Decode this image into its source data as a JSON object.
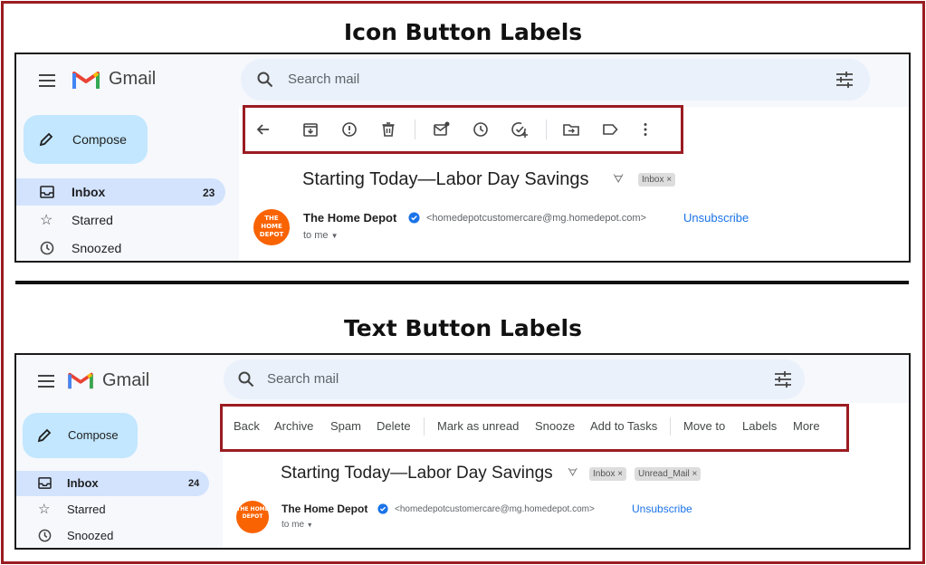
{
  "headings": {
    "top": "Icon Button Labels",
    "bottom": "Text Button Labels"
  },
  "colors": {
    "frame": "#9b1c22",
    "compose_bg": "#c2e7ff",
    "inbox_active": "#d3e3fd",
    "search_bg": "#eaf1fb",
    "link": "#1a73e8",
    "avatar": "#f96302"
  },
  "panel1": {
    "app_name": "Gmail",
    "search_placeholder": "Search mail",
    "compose": "Compose",
    "nav": [
      {
        "label": "Inbox",
        "count": "23",
        "icon": "inbox-icon"
      },
      {
        "label": "Starred",
        "count": "",
        "icon": "star-icon"
      },
      {
        "label": "Snoozed",
        "count": "",
        "icon": "clock-icon"
      }
    ],
    "toolbar_icons": [
      "back-arrow-icon",
      "archive-icon",
      "spam-icon",
      "delete-icon",
      "mark-unread-icon",
      "snooze-icon",
      "add-task-icon",
      "move-to-icon",
      "label-icon",
      "more-vert-icon"
    ],
    "subject": "Starting Today—Labor Day Savings",
    "chips": [
      "Inbox ×"
    ],
    "sender": "The Home Depot",
    "sender_email": "<homedepotcustomercare@mg.homedepot.com>",
    "unsubscribe": "Unsubscribe",
    "to_me": "to me",
    "avatar_text": "THE HOME DEPOT"
  },
  "panel2": {
    "app_name": "Gmail",
    "search_placeholder": "Search mail",
    "compose": "Compose",
    "nav": [
      {
        "label": "Inbox",
        "count": "24",
        "icon": "inbox-icon"
      },
      {
        "label": "Starred",
        "count": "",
        "icon": "star-icon"
      },
      {
        "label": "Snoozed",
        "count": "",
        "icon": "clock-icon"
      }
    ],
    "toolbar_labels": [
      "Back",
      "Archive",
      "Spam",
      "Delete",
      "Mark as unread",
      "Snooze",
      "Add to Tasks",
      "Move to",
      "Labels",
      "More"
    ],
    "subject": "Starting Today—Labor Day Savings",
    "chips": [
      "Inbox ×",
      "Unread_Mail ×"
    ],
    "sender": "The Home Depot",
    "sender_email": "<homedepotcustomercare@mg.homedepot.com>",
    "unsubscribe": "Unsubscribe",
    "to_me": "to me",
    "avatar_text": "THE HOME DEPOT"
  }
}
